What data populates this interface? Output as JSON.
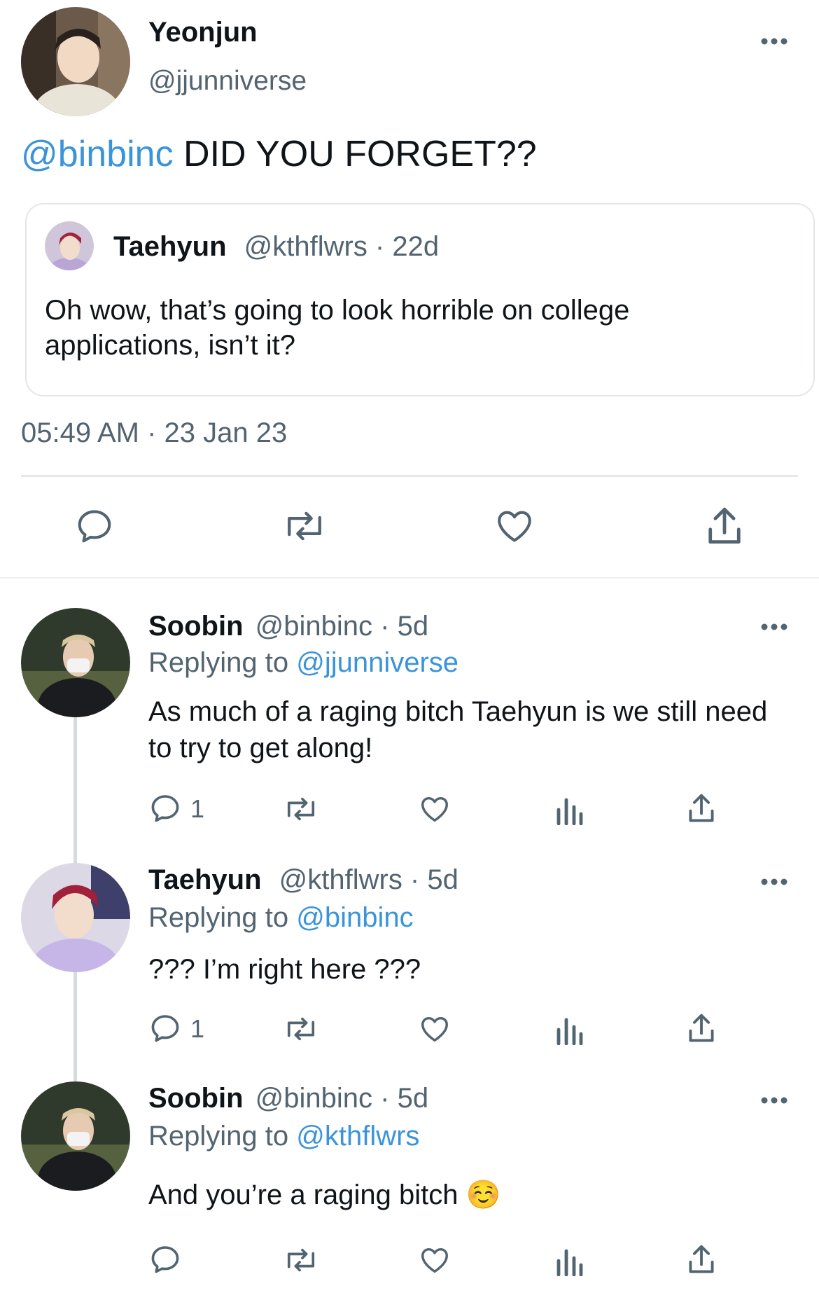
{
  "main_tweet": {
    "author_name": "Yeonjun",
    "author_handle": "@jjunniverse",
    "mention": "@binbinc",
    "text": " DID YOU FORGET??",
    "quoted": {
      "author_name": "Taehyun",
      "author_handle": "@kthflwrs",
      "separator": " · ",
      "age": "22d",
      "text": "Oh wow, that’s going to look horrible on college applications, isn’t it?"
    },
    "timestamp": "05:49 AM · 23 Jan 23"
  },
  "replies": [
    {
      "author_name": "Soobin",
      "author_handle": "@binbinc · 5d",
      "replying_prefix": "Replying to ",
      "replying_handle": "@jjunniverse",
      "text": "As much of a raging bitch Taehyun is we still need to try to get along!",
      "reply_count": "1"
    },
    {
      "author_name": "Taehyun",
      "author_handle": "@kthflwrs · 5d",
      "replying_prefix": "Replying to ",
      "replying_handle": "@binbinc",
      "text": "??? I’m right here ???",
      "reply_count": "1"
    },
    {
      "author_name": "Soobin",
      "author_handle": "@binbinc · 5d",
      "replying_prefix": "Replying to ",
      "replying_handle": "@kthflwrs",
      "text": "And you’re a raging bitch ☺️",
      "reply_count": ""
    }
  ],
  "colors": {
    "link": "#3b94d9",
    "muted": "#536471",
    "text": "#0f1419",
    "divider": "#e6e9eb"
  },
  "icons": [
    "more-icon",
    "reply-icon",
    "retweet-icon",
    "like-icon",
    "share-icon",
    "views-icon"
  ]
}
